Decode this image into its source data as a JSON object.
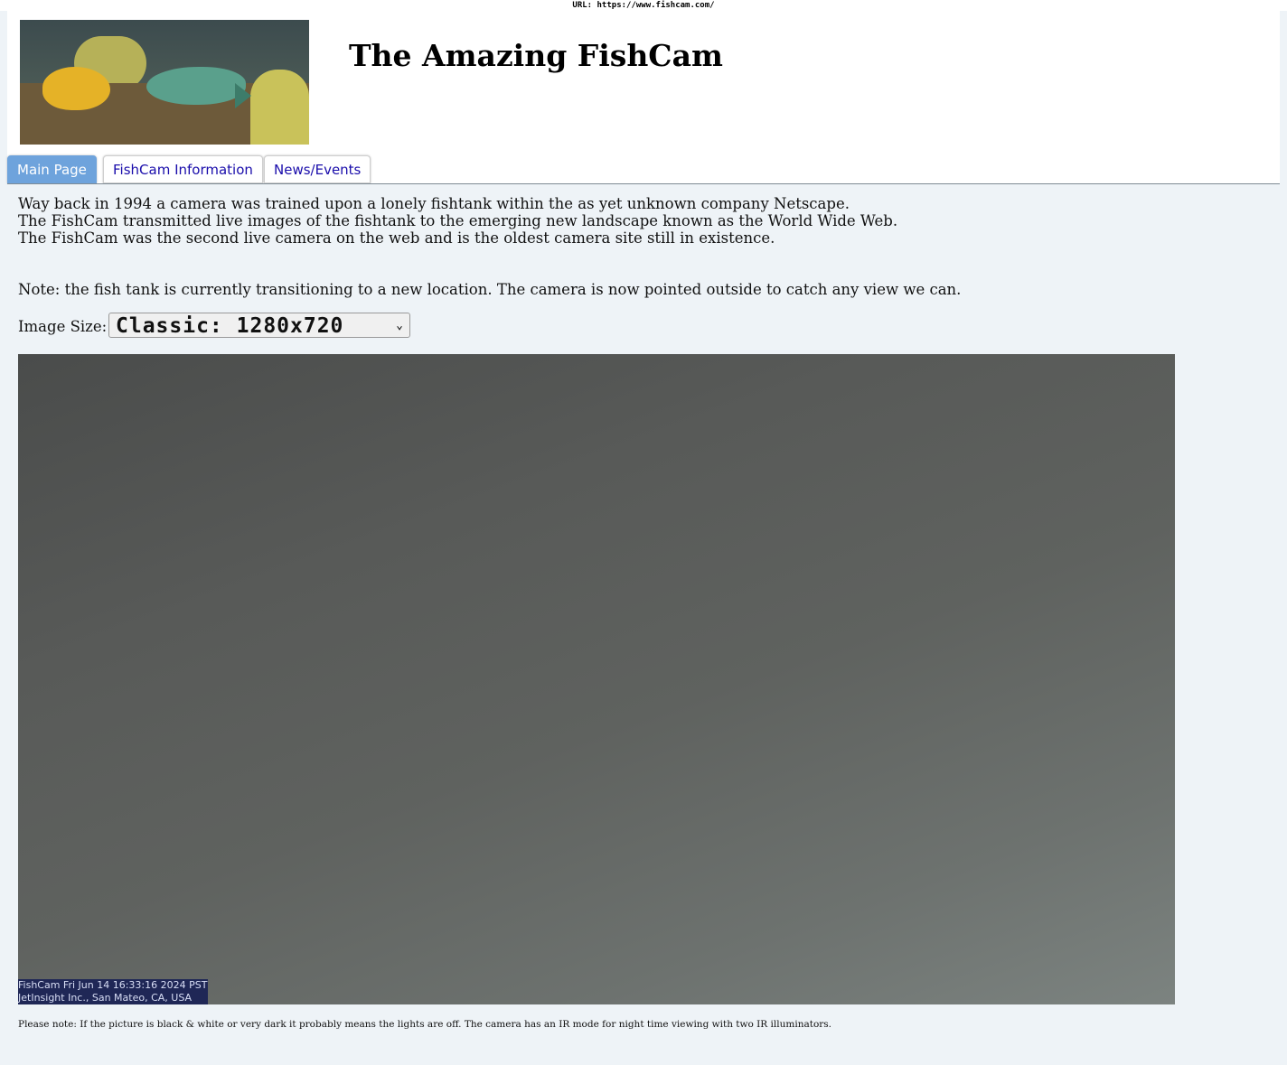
{
  "browser": {
    "url_text": "URL: https://www.fishcam.com/"
  },
  "header": {
    "title": "The Amazing FishCam"
  },
  "tabs": [
    {
      "label": "Main Page",
      "active": true
    },
    {
      "label": "FishCam Information",
      "active": false
    },
    {
      "label": "News/Events",
      "active": false
    }
  ],
  "intro": [
    "Way back in 1994 a camera was trained upon a lonely fishtank within the as yet unknown company Netscape.",
    "The FishCam transmitted live images of the fishtank to the emerging new landscape known as the World Wide Web.",
    "The FishCam was the second live camera on the web and is the oldest camera site still in existence."
  ],
  "note": "Note: the fish tank is currently transitioning to a new location. The camera is now pointed outside to catch any view we can.",
  "image_size": {
    "label": "Image Size:",
    "selected": "Classic: 1280x720"
  },
  "camera": {
    "overlay_line1": "FishCam Fri Jun 14 16:33:16 2024 PST",
    "overlay_line2": "JetInsight Inc., San Mateo, CA, USA"
  },
  "footer_note": "Please note: If the picture is black & white or very dark it probably means the lights are off. The camera has an IR mode for night time viewing with two IR illuminators.",
  "colors": {
    "tab_active": "#6ea3dc",
    "link": "#1a0dab",
    "content_bg": "#eef3f7",
    "overlay_bg": "#1f2756"
  }
}
